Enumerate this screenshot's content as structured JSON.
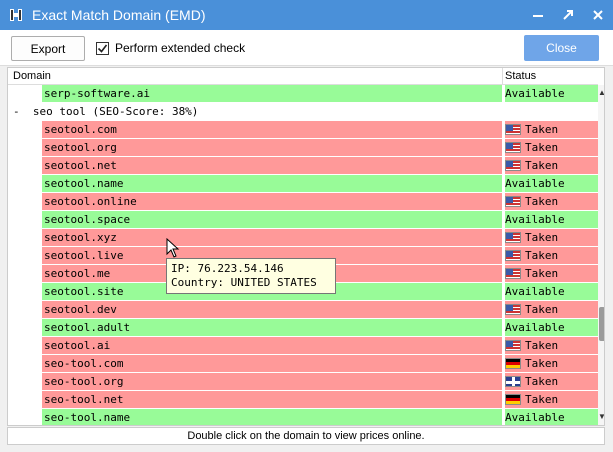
{
  "window": {
    "title": "Exact Match Domain (EMD)",
    "controls": [
      "minimize",
      "maximize",
      "close"
    ]
  },
  "toolbar": {
    "export_label": "Export",
    "extended_check_label": "Perform extended check",
    "extended_check_checked": true,
    "close_label": "Close"
  },
  "grid": {
    "columns": [
      "Domain",
      "Status"
    ],
    "rows": [
      {
        "type": "domain",
        "domain": "serp-software.ai",
        "status": "Available",
        "flag": ""
      },
      {
        "type": "group",
        "label": "-  seo tool (SEO-Score: 38%)"
      },
      {
        "type": "domain",
        "domain": "seotool.com",
        "status": "Taken",
        "flag": "us"
      },
      {
        "type": "domain",
        "domain": "seotool.org",
        "status": "Taken",
        "flag": "us"
      },
      {
        "type": "domain",
        "domain": "seotool.net",
        "status": "Taken",
        "flag": "us"
      },
      {
        "type": "domain",
        "domain": "seotool.name",
        "status": "Available",
        "flag": ""
      },
      {
        "type": "domain",
        "domain": "seotool.online",
        "status": "Taken",
        "flag": "us"
      },
      {
        "type": "domain",
        "domain": "seotool.space",
        "status": "Available",
        "flag": ""
      },
      {
        "type": "domain",
        "domain": "seotool.xyz",
        "status": "Taken",
        "flag": "us"
      },
      {
        "type": "domain",
        "domain": "seotool.live",
        "status": "Taken",
        "flag": "us"
      },
      {
        "type": "domain",
        "domain": "seotool.me",
        "status": "Taken",
        "flag": "us"
      },
      {
        "type": "domain",
        "domain": "seotool.site",
        "status": "Available",
        "flag": ""
      },
      {
        "type": "domain",
        "domain": "seotool.dev",
        "status": "Taken",
        "flag": "us"
      },
      {
        "type": "domain",
        "domain": "seotool.adult",
        "status": "Available",
        "flag": ""
      },
      {
        "type": "domain",
        "domain": "seotool.ai",
        "status": "Taken",
        "flag": "us"
      },
      {
        "type": "domain",
        "domain": "seo-tool.com",
        "status": "Taken",
        "flag": "de"
      },
      {
        "type": "domain",
        "domain": "seo-tool.org",
        "status": "Taken",
        "flag": "uk"
      },
      {
        "type": "domain",
        "domain": "seo-tool.net",
        "status": "Taken",
        "flag": "de"
      },
      {
        "type": "domain",
        "domain": "seo-tool.name",
        "status": "Available",
        "flag": ""
      }
    ]
  },
  "tooltip": {
    "line1": "IP: 76.223.54.146",
    "line2": "Country: UNITED STATES"
  },
  "statusbar": {
    "text": "Double click on the domain to view prices online."
  },
  "colors": {
    "titlebar": "#4a90d9",
    "available": "#98fb98",
    "taken": "#ff9999",
    "close_button": "#6fa5e8"
  }
}
